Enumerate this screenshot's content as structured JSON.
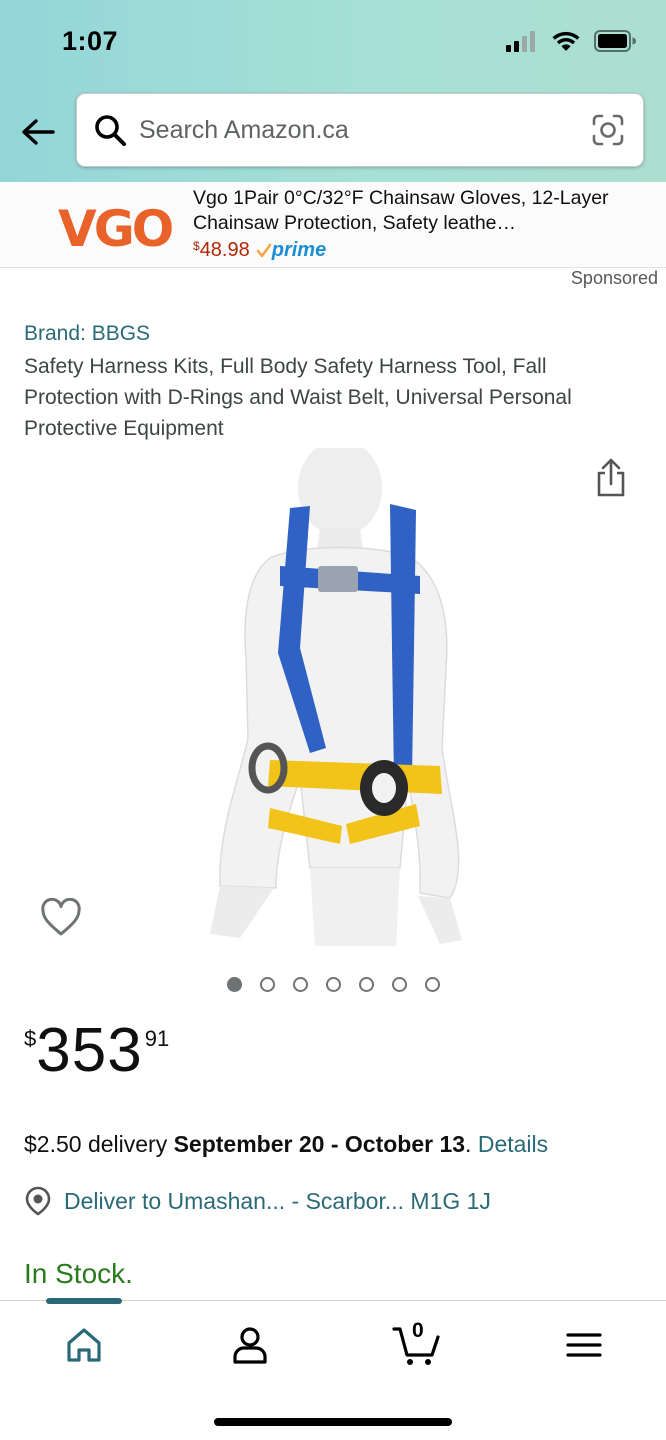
{
  "status_bar": {
    "time": "1:07"
  },
  "search": {
    "placeholder": "Search Amazon.ca"
  },
  "ad": {
    "logo_text": "VGO",
    "title": "Vgo 1Pair 0°C/32°F Chainsaw Gloves, 12-Layer Chainsaw Protection, Safety leathe…",
    "price_symbol": "$",
    "price": "48.98",
    "prime_label": "prime",
    "sponsored_label": "Sponsored"
  },
  "product": {
    "brand": "Brand: BBGS",
    "title": "Safety Harness Kits, Full Body Safety Harness Tool, Fall Protection with D-Rings and Waist Belt, Universal Personal Protective Equipment",
    "image_count": 7,
    "active_image_index": 0,
    "price": {
      "currency": "$",
      "whole": "353",
      "fraction": "91"
    },
    "delivery": {
      "fee_text": "$2.50 delivery ",
      "dates": "September 20 - October 13",
      "separator": ". ",
      "details_link": "Details"
    },
    "deliver_to": "Deliver to Umashan... - Scarbor... M1G 1J",
    "availability": "In Stock."
  },
  "bottom_nav": {
    "items": [
      "home-icon",
      "account-icon",
      "cart-icon",
      "menu-icon"
    ],
    "active": "home",
    "cart_count": "0"
  },
  "colors": {
    "link": "#2a6a78",
    "in_stock": "#2b7a1e",
    "ad_price": "#b12704",
    "prime": "#1c8fd4",
    "header_gradient_start": "#93d6d8",
    "header_gradient_end": "#acdfd0"
  }
}
